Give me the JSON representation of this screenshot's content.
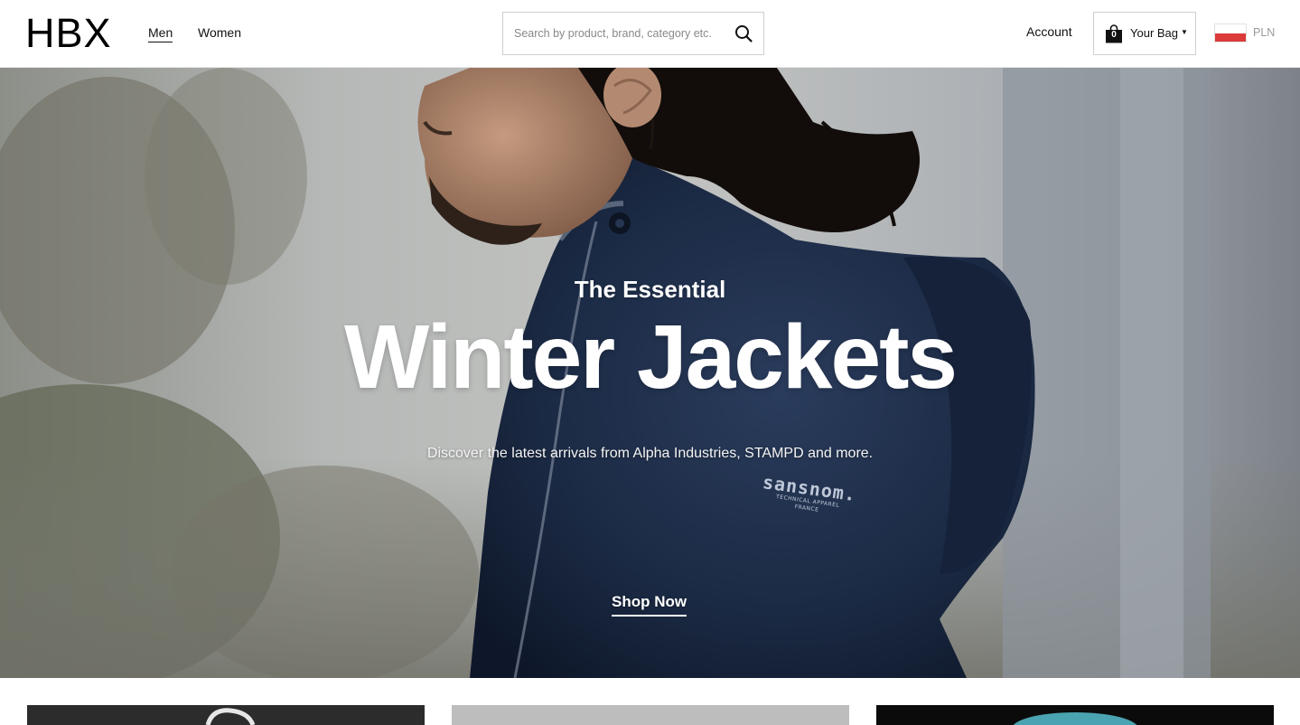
{
  "header": {
    "logo": "HBX",
    "nav": [
      {
        "label": "Men",
        "active": true
      },
      {
        "label": "Women",
        "active": false
      }
    ],
    "search": {
      "placeholder": "Search by product, brand, category etc."
    },
    "account_label": "Account",
    "bag": {
      "count": "0",
      "label": "Your Bag"
    },
    "currency": "PLN",
    "flag_colors": [
      "#ffffff",
      "#dc3a3a"
    ]
  },
  "hero": {
    "eyebrow": "The Essential",
    "title": "Winter Jackets",
    "subtitle": "Discover the latest arrivals from Alpha Industries, STAMPD and more.",
    "jacket_brand": "sansnom.",
    "jacket_tag": [
      "TECHNICAL APPAREL",
      "FRANCE"
    ],
    "cta": "Shop Now"
  },
  "colors": {
    "text": "#111111",
    "border": "#cfcfcf",
    "jacket": "#1b2a44",
    "flag_red": "#dc3a3a"
  }
}
